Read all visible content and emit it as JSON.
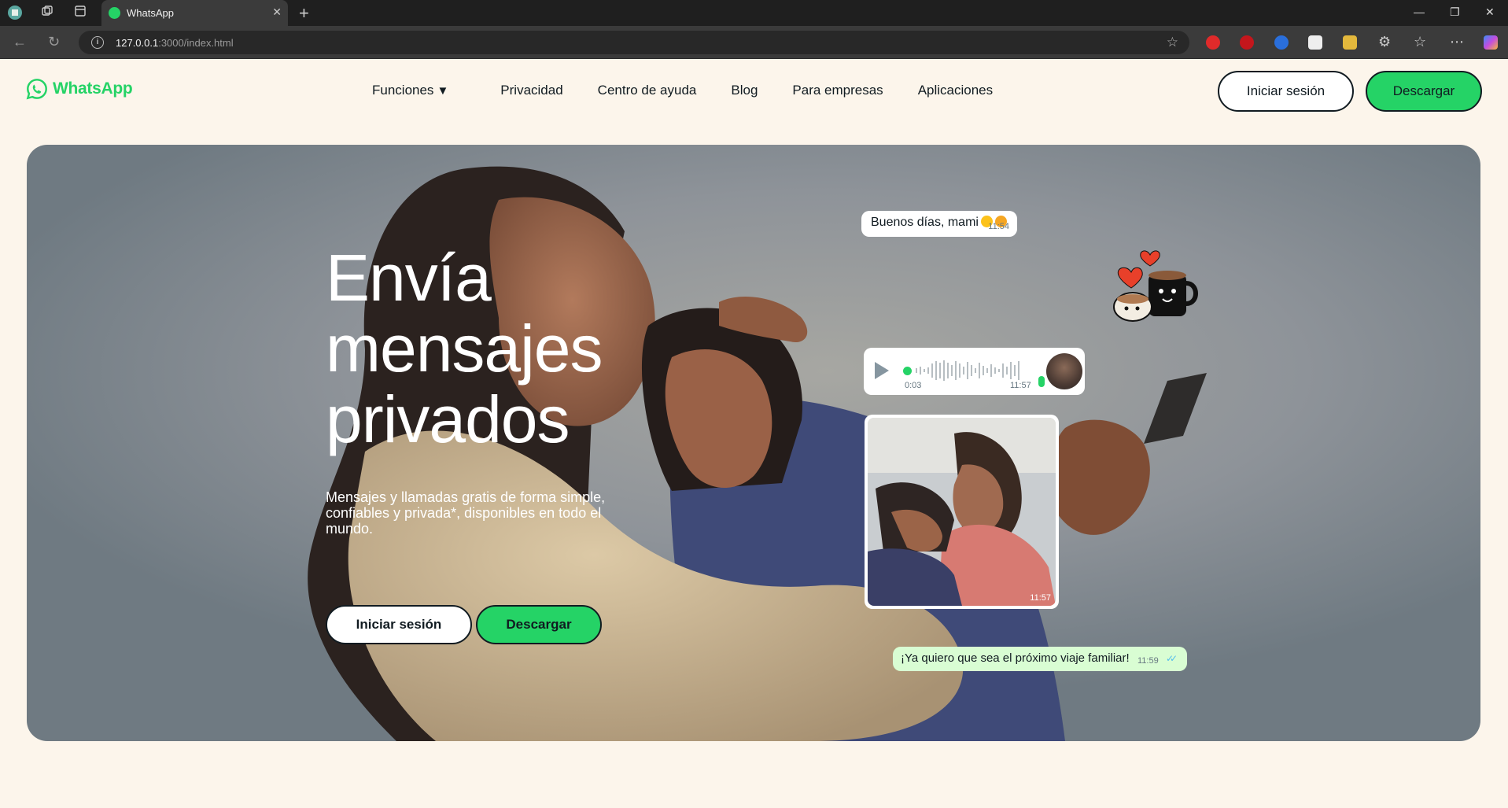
{
  "browser": {
    "tab_title": "WhatsApp",
    "tab_close": "✕",
    "new_tab": "+",
    "url_host": "127.0.0.1",
    "url_rest": ":3000/index.html",
    "minimize": "—",
    "restore": "❐",
    "close": "✕"
  },
  "header": {
    "logo_text": "WhatsApp",
    "nav": [
      {
        "label": "Funciones",
        "caret": "▼"
      },
      {
        "label": "Privacidad"
      },
      {
        "label": "Centro de ayuda"
      },
      {
        "label": "Blog"
      },
      {
        "label": "Para empresas"
      },
      {
        "label": "Aplicaciones"
      }
    ],
    "login_label": "Iniciar sesión",
    "download_label": "Descargar"
  },
  "hero": {
    "title_lines": [
      "Envía",
      "mensajes",
      "privados"
    ],
    "subtitle": "Mensajes y llamadas gratis de forma simple, confiables y privada*, disponibles en todo el mundo.",
    "login_label": "Iniciar sesión",
    "download_label": "Descargar"
  },
  "chat": {
    "message1": {
      "text": "Buenos días, mami",
      "time": "11:54"
    },
    "voice": {
      "duration": "0:03",
      "time": "11:57"
    },
    "photo": {
      "time": "11:57"
    },
    "message3": {
      "text": "¡Ya quiero que sea el próximo viaje familiar!",
      "time": "11:59"
    }
  },
  "colors": {
    "brand_green": "#25d366",
    "page_bg": "#fcf5eb",
    "text_dark": "#111b21",
    "outgoing_bubble": "#d9fdd3"
  }
}
